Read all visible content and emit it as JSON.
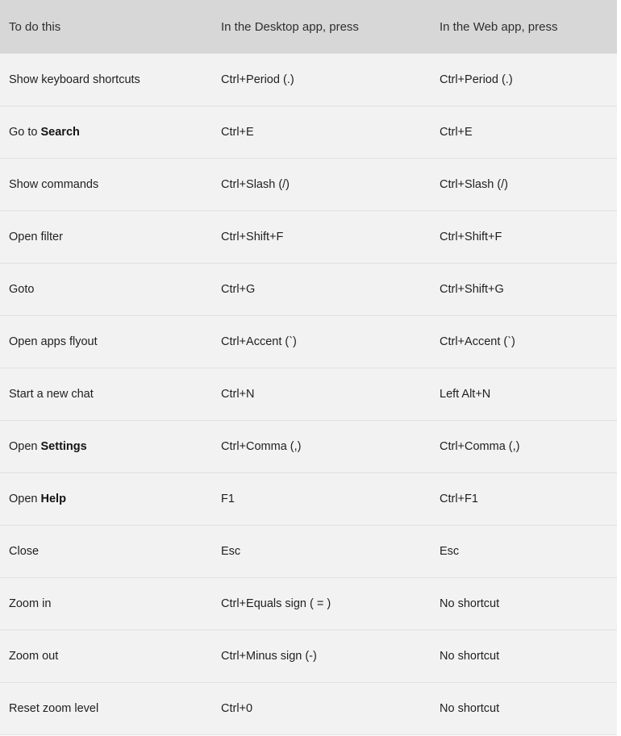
{
  "table": {
    "headers": {
      "task": "To do this",
      "desktop": "In the Desktop app, press",
      "web": "In the Web app, press"
    },
    "rows": [
      {
        "task": "Show keyboard shortcuts",
        "task_plain": "Show keyboard shortcuts",
        "task_bold": "",
        "desktop": "Ctrl+Period (.)",
        "web": "Ctrl+Period (.)"
      },
      {
        "task": "Go to Search",
        "task_plain": "Go to ",
        "task_bold": "Search",
        "desktop": "Ctrl+E",
        "web": "Ctrl+E"
      },
      {
        "task": "Show commands",
        "task_plain": "Show commands",
        "task_bold": "",
        "desktop": "Ctrl+Slash (/)",
        "web": "Ctrl+Slash (/)"
      },
      {
        "task": "Open filter",
        "task_plain": "Open filter",
        "task_bold": "",
        "desktop": "Ctrl+Shift+F",
        "web": "Ctrl+Shift+F"
      },
      {
        "task": "Goto",
        "task_plain": "Goto",
        "task_bold": "",
        "desktop": "Ctrl+G",
        "web": "Ctrl+Shift+G"
      },
      {
        "task": "Open apps flyout",
        "task_plain": "Open apps flyout",
        "task_bold": "",
        "desktop": "Ctrl+Accent (`)",
        "web": "Ctrl+Accent (`)"
      },
      {
        "task": "Start a new chat",
        "task_plain": "Start a new chat",
        "task_bold": "",
        "desktop": "Ctrl+N",
        "web": "Left Alt+N"
      },
      {
        "task": "Open Settings",
        "task_plain": "Open ",
        "task_bold": "Settings",
        "desktop": "Ctrl+Comma (,)",
        "web": "Ctrl+Comma (,)"
      },
      {
        "task": "Open Help",
        "task_plain": "Open ",
        "task_bold": "Help",
        "desktop": "F1",
        "web": "Ctrl+F1"
      },
      {
        "task": "Close",
        "task_plain": "Close",
        "task_bold": "",
        "desktop": "Esc",
        "web": "Esc"
      },
      {
        "task": "Zoom in",
        "task_plain": "Zoom in",
        "task_bold": "",
        "desktop": "Ctrl+Equals sign ( = )",
        "web": "No shortcut"
      },
      {
        "task": "Zoom out",
        "task_plain": "Zoom out",
        "task_bold": "",
        "desktop": "Ctrl+Minus sign (-)",
        "web": "No shortcut"
      },
      {
        "task": "Reset zoom level",
        "task_plain": "Reset zoom level",
        "task_bold": "",
        "desktop": "Ctrl+0",
        "web": "No shortcut"
      }
    ]
  },
  "colors": {
    "header_background": "#d7d7d7",
    "row_background": "#f2f2f2",
    "row_divider": "#e0e0e0",
    "text": "#1f1f1f",
    "header_text": "#2f2f2f"
  }
}
